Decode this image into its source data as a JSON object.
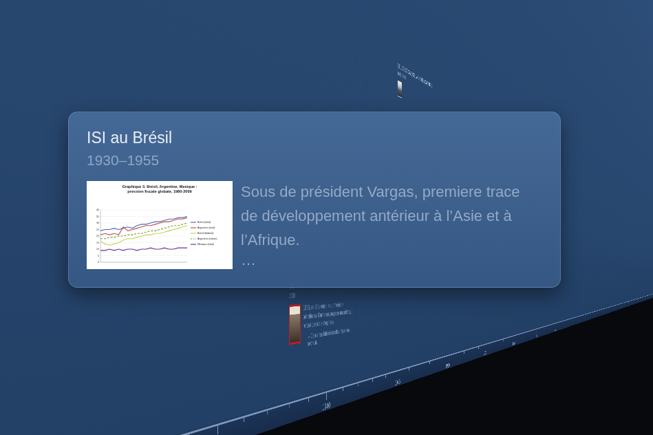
{
  "tooltip": {
    "title": "ISI au Brésil",
    "dates": "1930–1955",
    "description": "Sous de président Vargas, premiere trace de développement antérieur à l’Asie et à l’Afrique.",
    "more": "…",
    "chart": {
      "title_lines": [
        "Graphique 3. Brésil, Argentine, Mexique :",
        "pression fiscale globale, 1980-2009"
      ],
      "y_ticks": [
        "40",
        "35",
        "30",
        "25",
        "20",
        "15",
        "10",
        "5",
        "0"
      ],
      "y_max": 40,
      "series": [
        {
          "name": "Brésil (total)",
          "color": "#4a6fb5",
          "dashed": false,
          "values": [
            24,
            25,
            25,
            26,
            25,
            26,
            27,
            26,
            28,
            29,
            29,
            30,
            31,
            31,
            32,
            33,
            33,
            34,
            34,
            35
          ]
        },
        {
          "name": "Argentine (total)",
          "color": "#c0504d",
          "dashed": false,
          "values": [
            21,
            22,
            21,
            22,
            21,
            27,
            24,
            25,
            26,
            27,
            28,
            28,
            29,
            30,
            31,
            31,
            32,
            33,
            33,
            34
          ]
        },
        {
          "name": "Brésil (fédéral)",
          "color": "#c9d44a",
          "dashed": false,
          "values": [
            16,
            14,
            13,
            14,
            15,
            17,
            18,
            18,
            19,
            20,
            21,
            21,
            22,
            22,
            23,
            24,
            25,
            26,
            27,
            28
          ]
        },
        {
          "name": "Argentine (nation)",
          "color": "#6f9a3a",
          "dashed": true,
          "values": [
            18,
            18,
            19,
            19,
            20,
            20,
            21,
            21,
            22,
            22,
            23,
            24,
            24,
            25,
            26,
            27,
            28,
            28,
            29,
            30
          ]
        },
        {
          "name": "Mexique (total)",
          "color": "#7030a0",
          "dashed": false,
          "values": [
            9,
            9,
            10,
            9,
            10,
            9,
            10,
            10,
            9,
            10,
            10,
            11,
            10,
            10,
            11,
            10,
            10,
            11,
            11,
            11
          ]
        }
      ]
    }
  },
  "events": [
    {
      "title": "Cardenas",
      "date": "1938",
      "kind": "cover",
      "text": "1938, conflits entre les entreprises pétrolières. Cardenas propose un arbitrage refusé par les entreprises.",
      "note": "↳ Cardenas fait nationaliser tous les secteur..."
    },
    {
      "title": "ÉTUDE DE CAS DE LA CORÉE DU SUD 2",
      "date": "1945–1960",
      "kind": "portrait",
      "text": "",
      "note": ""
    }
  ],
  "axis": {
    "ticks": [
      "1940",
      "1945",
      "1950",
      "1955",
      "1960",
      "1965",
      "1970"
    ]
  }
}
